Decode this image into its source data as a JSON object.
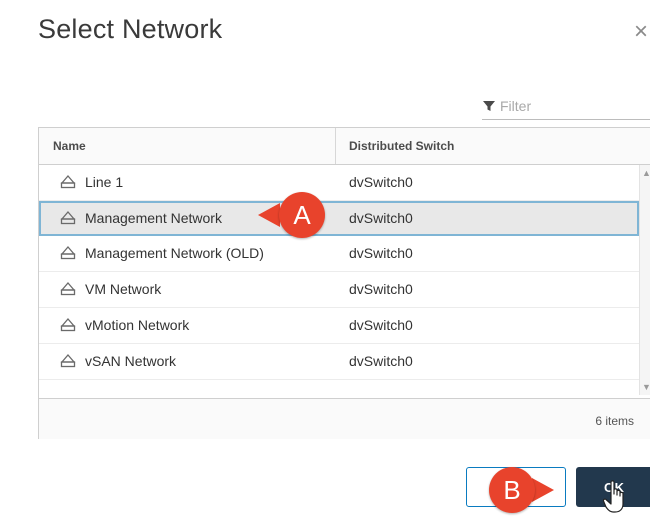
{
  "dialog": {
    "title": "Select Network",
    "close_glyph": "×"
  },
  "filter": {
    "label": "Filter",
    "icon": "filter-funnel-icon"
  },
  "table": {
    "columns": [
      "Name",
      "Distributed Switch"
    ],
    "rows": [
      {
        "name": "Line 1",
        "switch": "dvSwitch0",
        "icon": "network-icon"
      },
      {
        "name": "Management Network",
        "switch": "dvSwitch0",
        "icon": "network-icon",
        "selected": true
      },
      {
        "name": "Management Network (OLD)",
        "switch": "dvSwitch0",
        "icon": "network-icon"
      },
      {
        "name": "VM Network",
        "switch": "dvSwitch0",
        "icon": "network-icon"
      },
      {
        "name": "vMotion Network",
        "switch": "dvSwitch0",
        "icon": "network-icon"
      },
      {
        "name": "vSAN Network",
        "switch": "dvSwitch0",
        "icon": "network-icon"
      }
    ],
    "item_count": "6 items"
  },
  "buttons": {
    "cancel_label": "",
    "ok_label": "OK"
  },
  "callouts": {
    "a": "A",
    "b": "B"
  },
  "colors": {
    "accent": "#0a7bc0",
    "primary_button": "#22384d",
    "callout": "#e8432c",
    "selection": "#e8e8e8"
  }
}
